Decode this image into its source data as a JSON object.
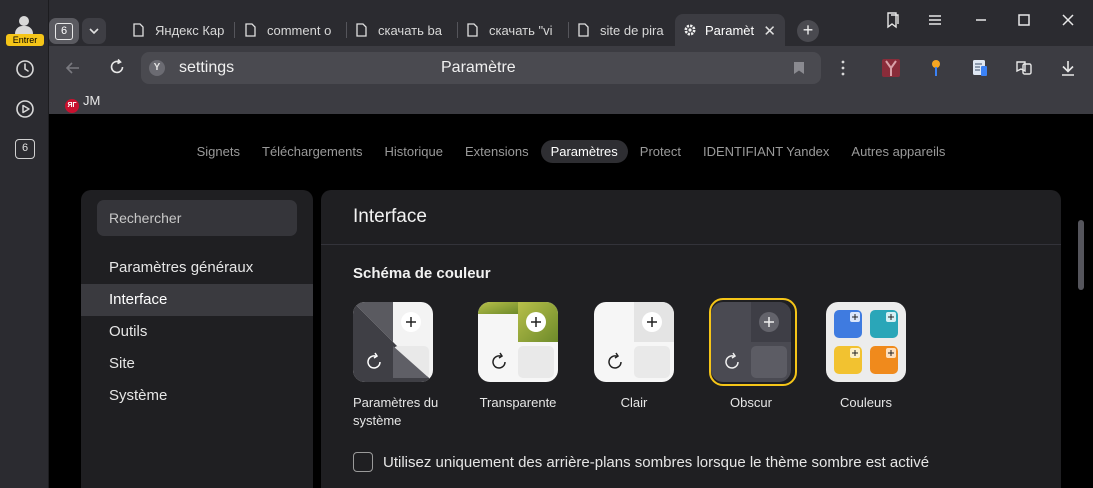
{
  "rail": {
    "enter_badge": "Entrer",
    "tab_count": "6"
  },
  "tabs": [
    {
      "label": "Яндекс Кар"
    },
    {
      "label": "comment o"
    },
    {
      "label": "скачать ba"
    },
    {
      "label": "скачать \"vi"
    },
    {
      "label": "site de pira"
    },
    {
      "label": "Paramètr",
      "active": true
    }
  ],
  "tab_counter": "6",
  "toolbar": {
    "url": "settings",
    "page_title": "Paramètre",
    "search_engine_letter": "Y"
  },
  "bookmarks": [
    {
      "label": "JM",
      "favicon_text": "ЯГ"
    }
  ],
  "topnav": [
    {
      "label": "Signets"
    },
    {
      "label": "Téléchargements"
    },
    {
      "label": "Historique"
    },
    {
      "label": "Extensions"
    },
    {
      "label": "Paramètres",
      "active": true
    },
    {
      "label": "Protect"
    },
    {
      "label": "IDENTIFIANT Yandex"
    },
    {
      "label": "Autres appareils"
    }
  ],
  "sidebar": {
    "search_placeholder": "Rechercher",
    "items": [
      {
        "label": "Paramètres généraux"
      },
      {
        "label": "Interface",
        "active": true
      },
      {
        "label": "Outils"
      },
      {
        "label": "Site"
      },
      {
        "label": "Système"
      }
    ]
  },
  "main": {
    "title": "Interface",
    "section_title": "Schéma de couleur",
    "schemes": [
      {
        "label": "Paramètres du système"
      },
      {
        "label": "Transparente"
      },
      {
        "label": "Clair"
      },
      {
        "label": "Obscur",
        "selected": true
      },
      {
        "label": "Couleurs"
      }
    ],
    "dark_bg_checkbox": {
      "label": "Utilisez uniquement des arrière-plans sombres lorsque le thème sombre est activé",
      "checked": false
    }
  },
  "colors": {
    "accent_selected": "#f5c518",
    "active_bg": "#3a3a3f"
  }
}
